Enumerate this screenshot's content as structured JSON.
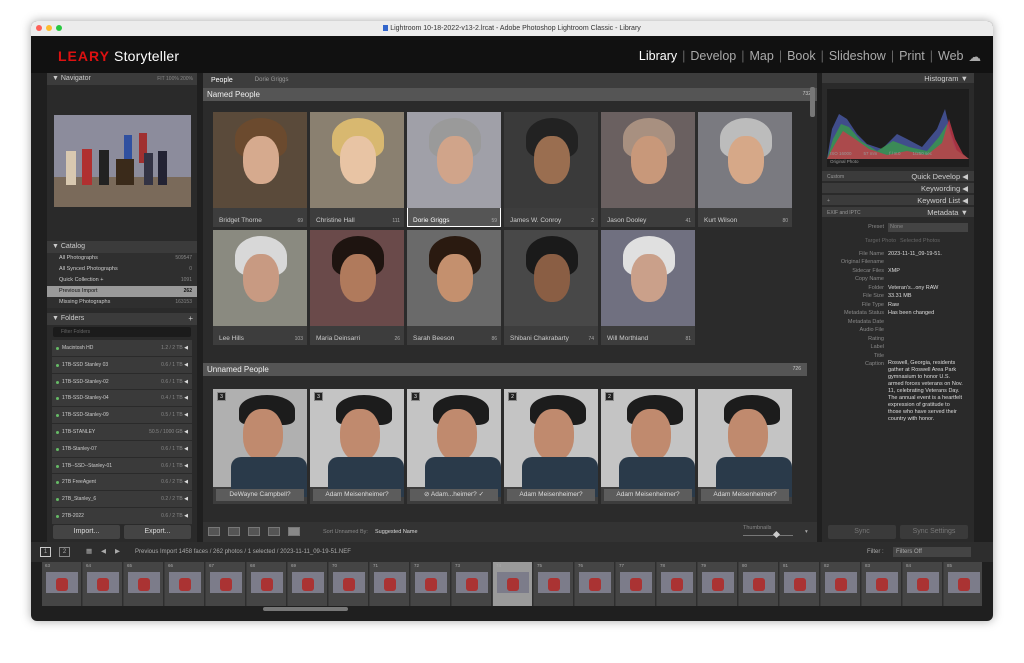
{
  "window": {
    "title": "Lightroom 10-18-2022-v13-2.lrcat - Adobe Photoshop Lightroom Classic - Library"
  },
  "identity": {
    "brand": "LEARY",
    "product": "Storyteller"
  },
  "modules": [
    {
      "label": "Library",
      "active": true
    },
    {
      "label": "Develop"
    },
    {
      "label": "Map"
    },
    {
      "label": "Book"
    },
    {
      "label": "Slideshow"
    },
    {
      "label": "Print"
    },
    {
      "label": "Web"
    }
  ],
  "left_panel": {
    "navigator": {
      "title": "Navigator",
      "zoom": "FIT  100%  200%"
    },
    "catalog": {
      "title": "Catalog",
      "items": [
        {
          "label": "All Photographs",
          "count": "509547"
        },
        {
          "label": "All Synced Photographs",
          "count": "0"
        },
        {
          "label": "Quick Collection +",
          "count": "1091"
        },
        {
          "label": "Previous Import",
          "count": "262"
        },
        {
          "label": "Missing Photographs",
          "count": "163153"
        }
      ]
    },
    "folders": {
      "title": "Folders",
      "filter_placeholder": "Filter Folders",
      "drives": [
        {
          "label": "Macintosh HD",
          "size": "1.2 / 2 TB"
        },
        {
          "label": "1TB-SSD Stanley 03",
          "size": "0.6 / 1 TB"
        },
        {
          "label": "1TB-SSD-Stanley-02",
          "size": "0.6 / 1 TB"
        },
        {
          "label": "1TB-SSD-Stanley-04",
          "size": "0.4 / 1 TB"
        },
        {
          "label": "1TB-SSD-Stanley-09",
          "size": "0.5 / 1 TB"
        },
        {
          "label": "1TB-STANLEY",
          "size": "50.5 / 1000 GB"
        },
        {
          "label": "1TB-Stanley-07",
          "size": "0.6 / 1 TB"
        },
        {
          "label": "1TB--SSD--Stanley-01",
          "size": "0.6 / 1 TB"
        },
        {
          "label": "2TB FreeAgent",
          "size": "0.6 / 2 TB"
        },
        {
          "label": "2TB_Stanley_6",
          "size": "0.2 / 2 TB"
        },
        {
          "label": "2TB-2022",
          "size": "0.6 / 2 TB"
        }
      ]
    },
    "import_label": "Import...",
    "export_label": "Export..."
  },
  "center": {
    "tabs": {
      "people": "People",
      "person": "Dorie Griggs"
    },
    "named": {
      "title": "Named People",
      "count": "732",
      "people": [
        {
          "name": "Bridget Thorne",
          "count": "69"
        },
        {
          "name": "Christine Hall",
          "count": "111"
        },
        {
          "name": "Dorie Griggs",
          "count": "59"
        },
        {
          "name": "James W. Conroy",
          "count": "2"
        },
        {
          "name": "Jason Dooley",
          "count": "41"
        },
        {
          "name": "Kurt Wilson",
          "count": "80"
        },
        {
          "name": "Lee Hills",
          "count": "103"
        },
        {
          "name": "Maria Deinsarri",
          "count": "26"
        },
        {
          "name": "Sarah Beeson",
          "count": "86"
        },
        {
          "name": "Shibani Chakrabarty",
          "count": "74"
        },
        {
          "name": "Will Morthland",
          "count": "81"
        }
      ]
    },
    "unnamed": {
      "title": "Unnamed People",
      "count": "726",
      "people": [
        {
          "name": "DeWayne Campbell?",
          "badge": "3"
        },
        {
          "name": "Adam Meisenheimer?",
          "badge": "3"
        },
        {
          "name": "Adam...heimer?",
          "badge": "3"
        },
        {
          "name": "Adam Meisenheimer?",
          "badge": "2"
        },
        {
          "name": "Adam Meisenheimer?",
          "badge": "2"
        },
        {
          "name": "Adam Meisenheimer?",
          "badge": ""
        }
      ]
    },
    "toolbar": {
      "sort_label": "Sort Unnamed By:",
      "sort_value": "Suggested Name",
      "thumbs_label": "Thumbnails"
    }
  },
  "right_panel": {
    "histogram": {
      "title": "Histogram",
      "iso": "ISO 16000",
      "focal": "57 mm",
      "aperture": "f / 8.0",
      "shutter": "1/250 sec",
      "original": "Original Photo"
    },
    "quick_develop": {
      "preset": "Custom",
      "title": "Quick Develop"
    },
    "keywording": "Keywording",
    "keyword_list": "Keyword List",
    "metadata": {
      "title": "Metadata",
      "preset_sel": "EXIF and IPTC",
      "preset_label": "Preset",
      "preset_value": "None",
      "target_photo": "Target Photo",
      "selected_photos": "Selected Photos",
      "fields": [
        {
          "k": "File Name",
          "v": "2023-11-11_09-19-51."
        },
        {
          "k": "Original Filename",
          "v": ""
        },
        {
          "k": "Sidecar Files",
          "v": "XMP"
        },
        {
          "k": "Copy Name",
          "v": ""
        },
        {
          "k": "Folder",
          "v": "Veteran's...ony RAW"
        },
        {
          "k": "File Size",
          "v": "33.31 MB"
        },
        {
          "k": "File Type",
          "v": "Raw"
        },
        {
          "k": "Metadata Status",
          "v": "Has been changed"
        },
        {
          "k": "Metadata Date",
          "v": ""
        },
        {
          "k": "Audio File",
          "v": ""
        },
        {
          "k": "Rating",
          "v": ""
        },
        {
          "k": "Label",
          "v": ""
        },
        {
          "k": "Title",
          "v": ""
        },
        {
          "k": "Caption",
          "v": "Roswell, Georgia, residents gather at Roswell Area Park gymnasium to honor U.S. armed forces veterans on Nov. 11, celebrating Veterans Day. The annual event is a heartfelt expression of gratitude to those who have served their country with honor."
        }
      ]
    },
    "sync": "Sync",
    "sync_settings": "Sync Settings"
  },
  "filmstrip": {
    "pages": [
      "1",
      "2"
    ],
    "status": "Previous Import   1458 faces / 262 photos / 1 selected / 2023-11-11_09-19-51.NEF",
    "filter_label": "Filter :",
    "filter_value": "Filters Off",
    "frames": [
      "63",
      "64",
      "65",
      "66",
      "67",
      "68",
      "69",
      "70",
      "71",
      "72",
      "73",
      "74",
      "75",
      "76",
      "77",
      "78",
      "79",
      "80",
      "81",
      "82",
      "83",
      "84",
      "85"
    ]
  }
}
